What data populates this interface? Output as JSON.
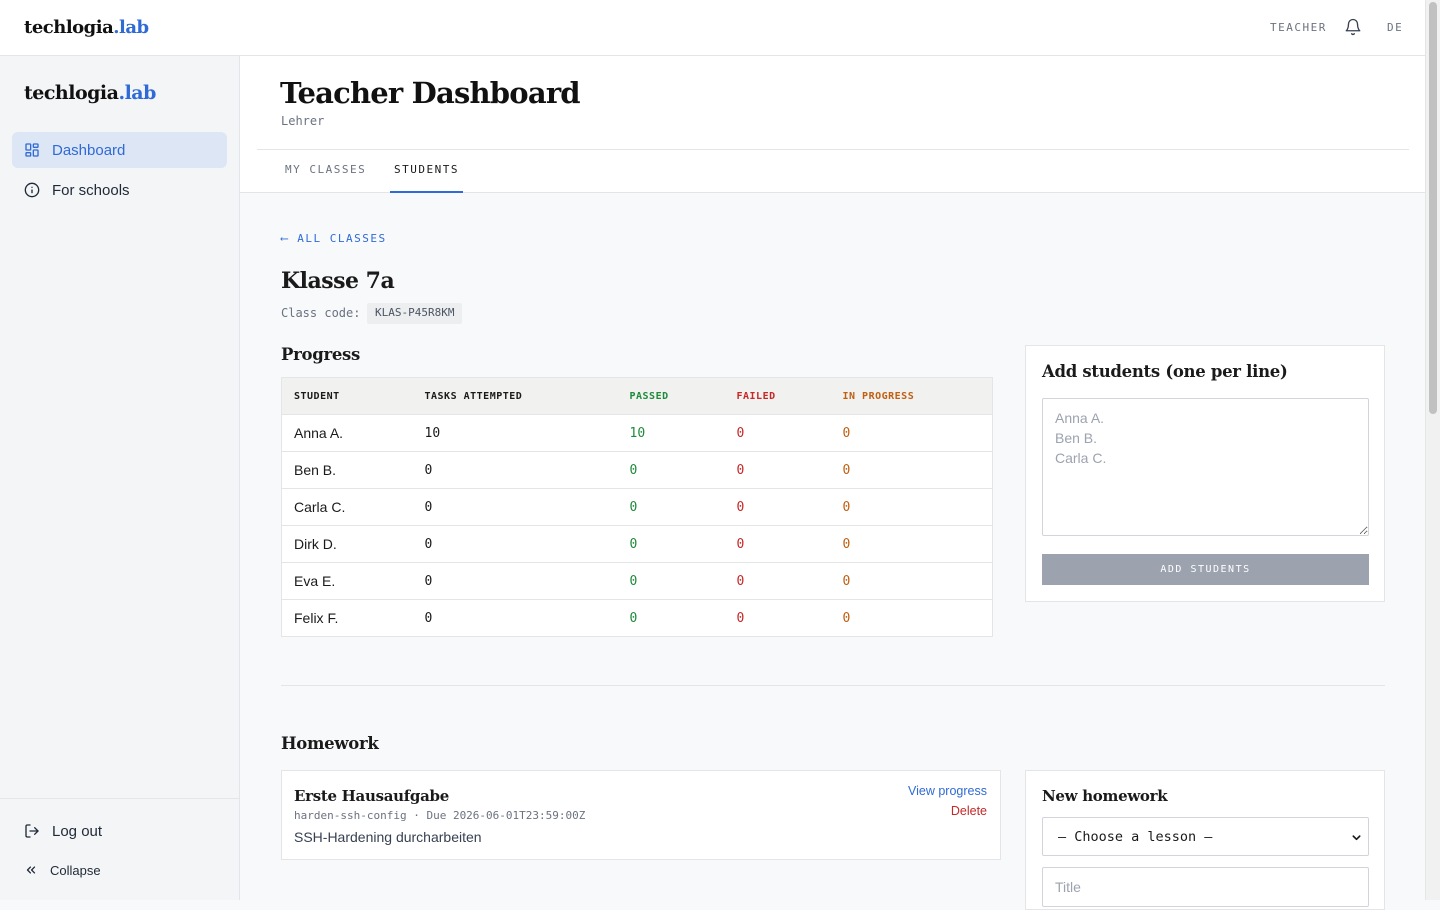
{
  "brand": {
    "name": "techlogia",
    "suffix": ".lab"
  },
  "topbar": {
    "role": "TEACHER",
    "language": "DE"
  },
  "sidebar": {
    "items": [
      {
        "label": "Dashboard",
        "icon": "dashboard-grid-icon",
        "active": true
      },
      {
        "label": "For schools",
        "icon": "info-circle-icon",
        "active": false
      }
    ],
    "logout": "Log out",
    "collapse": "Collapse"
  },
  "header": {
    "title": "Teacher Dashboard",
    "subtitle": "Lehrer"
  },
  "tabs": [
    {
      "label": "MY CLASSES",
      "active": false
    },
    {
      "label": "STUDENTS",
      "active": true
    }
  ],
  "class_view": {
    "back_label": "⟵ ALL CLASSES",
    "title": "Klasse 7a",
    "code_label": "Class code:",
    "code": "KLAS-P45R8KM"
  },
  "progress": {
    "heading": "Progress",
    "columns": [
      "STUDENT",
      "TASKS ATTEMPTED",
      "PASSED",
      "FAILED",
      "IN PROGRESS"
    ],
    "rows": [
      {
        "student": "Anna A.",
        "attempted": "10",
        "passed": "10",
        "failed": "0",
        "in_progress": "0"
      },
      {
        "student": "Ben B.",
        "attempted": "0",
        "passed": "0",
        "failed": "0",
        "in_progress": "0"
      },
      {
        "student": "Carla C.",
        "attempted": "0",
        "passed": "0",
        "failed": "0",
        "in_progress": "0"
      },
      {
        "student": "Dirk D.",
        "attempted": "0",
        "passed": "0",
        "failed": "0",
        "in_progress": "0"
      },
      {
        "student": "Eva E.",
        "attempted": "0",
        "passed": "0",
        "failed": "0",
        "in_progress": "0"
      },
      {
        "student": "Felix F.",
        "attempted": "0",
        "passed": "0",
        "failed": "0",
        "in_progress": "0"
      }
    ]
  },
  "add_students": {
    "heading": "Add students (one per line)",
    "placeholder": "Anna A.\nBen B.\nCarla C.",
    "button": "ADD STUDENTS"
  },
  "homework": {
    "heading": "Homework",
    "items": [
      {
        "title": "Erste Hausaufgabe",
        "meta": "harden-ssh-config · Due 2026-06-01T23:59:00Z",
        "description": "SSH-Hardening durcharbeiten",
        "view_label": "View progress",
        "delete_label": "Delete"
      }
    ]
  },
  "new_homework": {
    "heading": "New homework",
    "lesson_select": "— Choose a lesson —",
    "title_placeholder": "Title"
  },
  "colors": {
    "accent": "#2f6ad6",
    "passed": "#1f8a3b",
    "failed": "#c62828",
    "in_progress": "#c05f12",
    "button_disabled": "#9ca3af"
  }
}
